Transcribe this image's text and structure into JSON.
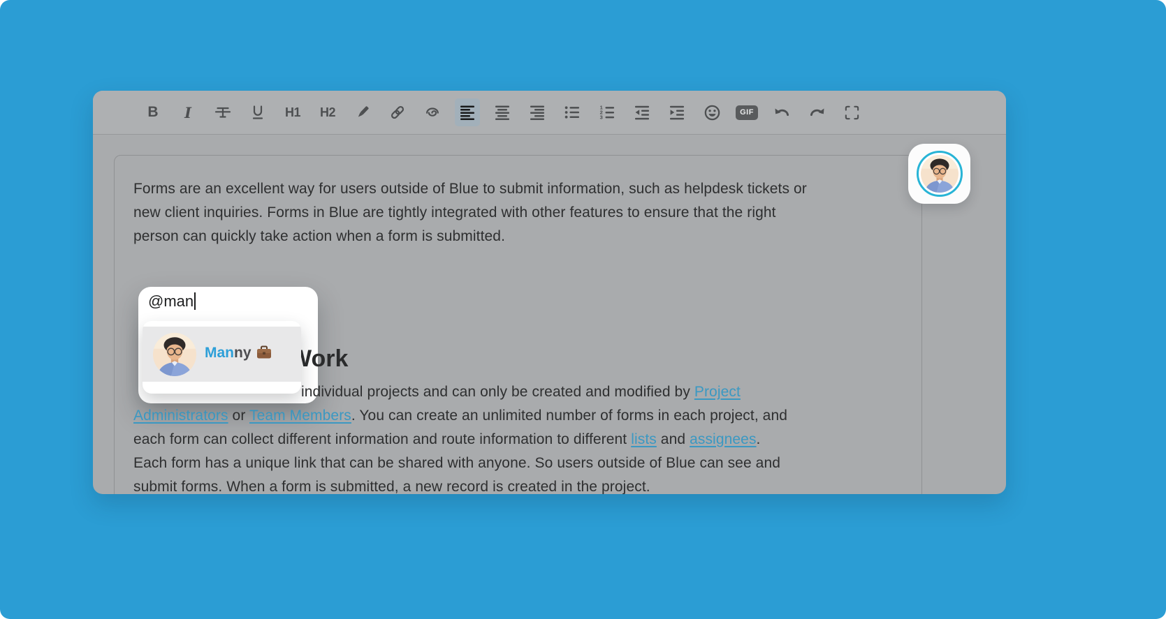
{
  "colors": {
    "page_background": "#2b9dd4",
    "window_gray": "#a9abad",
    "link_teal": "#3b98c2",
    "mention_match_blue": "#2d9fd8",
    "avatar_ring_teal": "#28b4d6"
  },
  "toolbar": {
    "buttons": [
      {
        "name": "bold",
        "label": "B"
      },
      {
        "name": "italic",
        "label": "I"
      },
      {
        "name": "strikethrough"
      },
      {
        "name": "underline"
      },
      {
        "name": "heading-1",
        "label": "H1"
      },
      {
        "name": "heading-2",
        "label": "H2"
      },
      {
        "name": "highlight-pen"
      },
      {
        "name": "insert-link"
      },
      {
        "name": "attach-file"
      },
      {
        "name": "align-left",
        "active": true
      },
      {
        "name": "align-center"
      },
      {
        "name": "align-right"
      },
      {
        "name": "bulleted-list"
      },
      {
        "name": "numbered-list"
      },
      {
        "name": "outdent"
      },
      {
        "name": "indent"
      },
      {
        "name": "emoji"
      },
      {
        "name": "gif",
        "label": "GIF"
      },
      {
        "name": "undo"
      },
      {
        "name": "redo"
      },
      {
        "name": "fullscreen"
      }
    ]
  },
  "document": {
    "p1_lines": [
      "Forms are an excellent way for users outside of Blue to submit information, such as helpdesk tickets or",
      "new client inquiries. Forms in Blue are tightly integrated with other features to ensure that the right",
      "person can quickly take action when a form is submitted."
    ],
    "heading_visible": "Work",
    "p2_line1": {
      "segments": [
        {
          "text": "individual projects and can only be created and modified by "
        },
        {
          "text": "Project",
          "link": true
        }
      ]
    },
    "p2_lines": [
      {
        "segments": [
          {
            "text": "Administrators",
            "link": true
          },
          {
            "text": " or "
          },
          {
            "text": "Team Members",
            "link": true
          },
          {
            "text": ". You can create an unlimited number of forms in each project, and"
          }
        ]
      },
      {
        "segments": [
          {
            "text": "each form can collect different information and route information to different "
          },
          {
            "text": "lists",
            "link": true
          },
          {
            "text": " and "
          },
          {
            "text": "assignees",
            "link": true
          },
          {
            "text": "."
          }
        ]
      },
      {
        "segments": [
          {
            "text": "Each form has a unique link that can be shared with anyone. So users outside of Blue can see and"
          }
        ]
      },
      {
        "segments": [
          {
            "text": "submit forms. When a form is submitted, a new record is created in the project."
          }
        ]
      }
    ]
  },
  "mention": {
    "query": "@man",
    "suggestion_match": "Man",
    "suggestion_rest": "ny",
    "suggestion_badge": "briefcase-emoji"
  }
}
